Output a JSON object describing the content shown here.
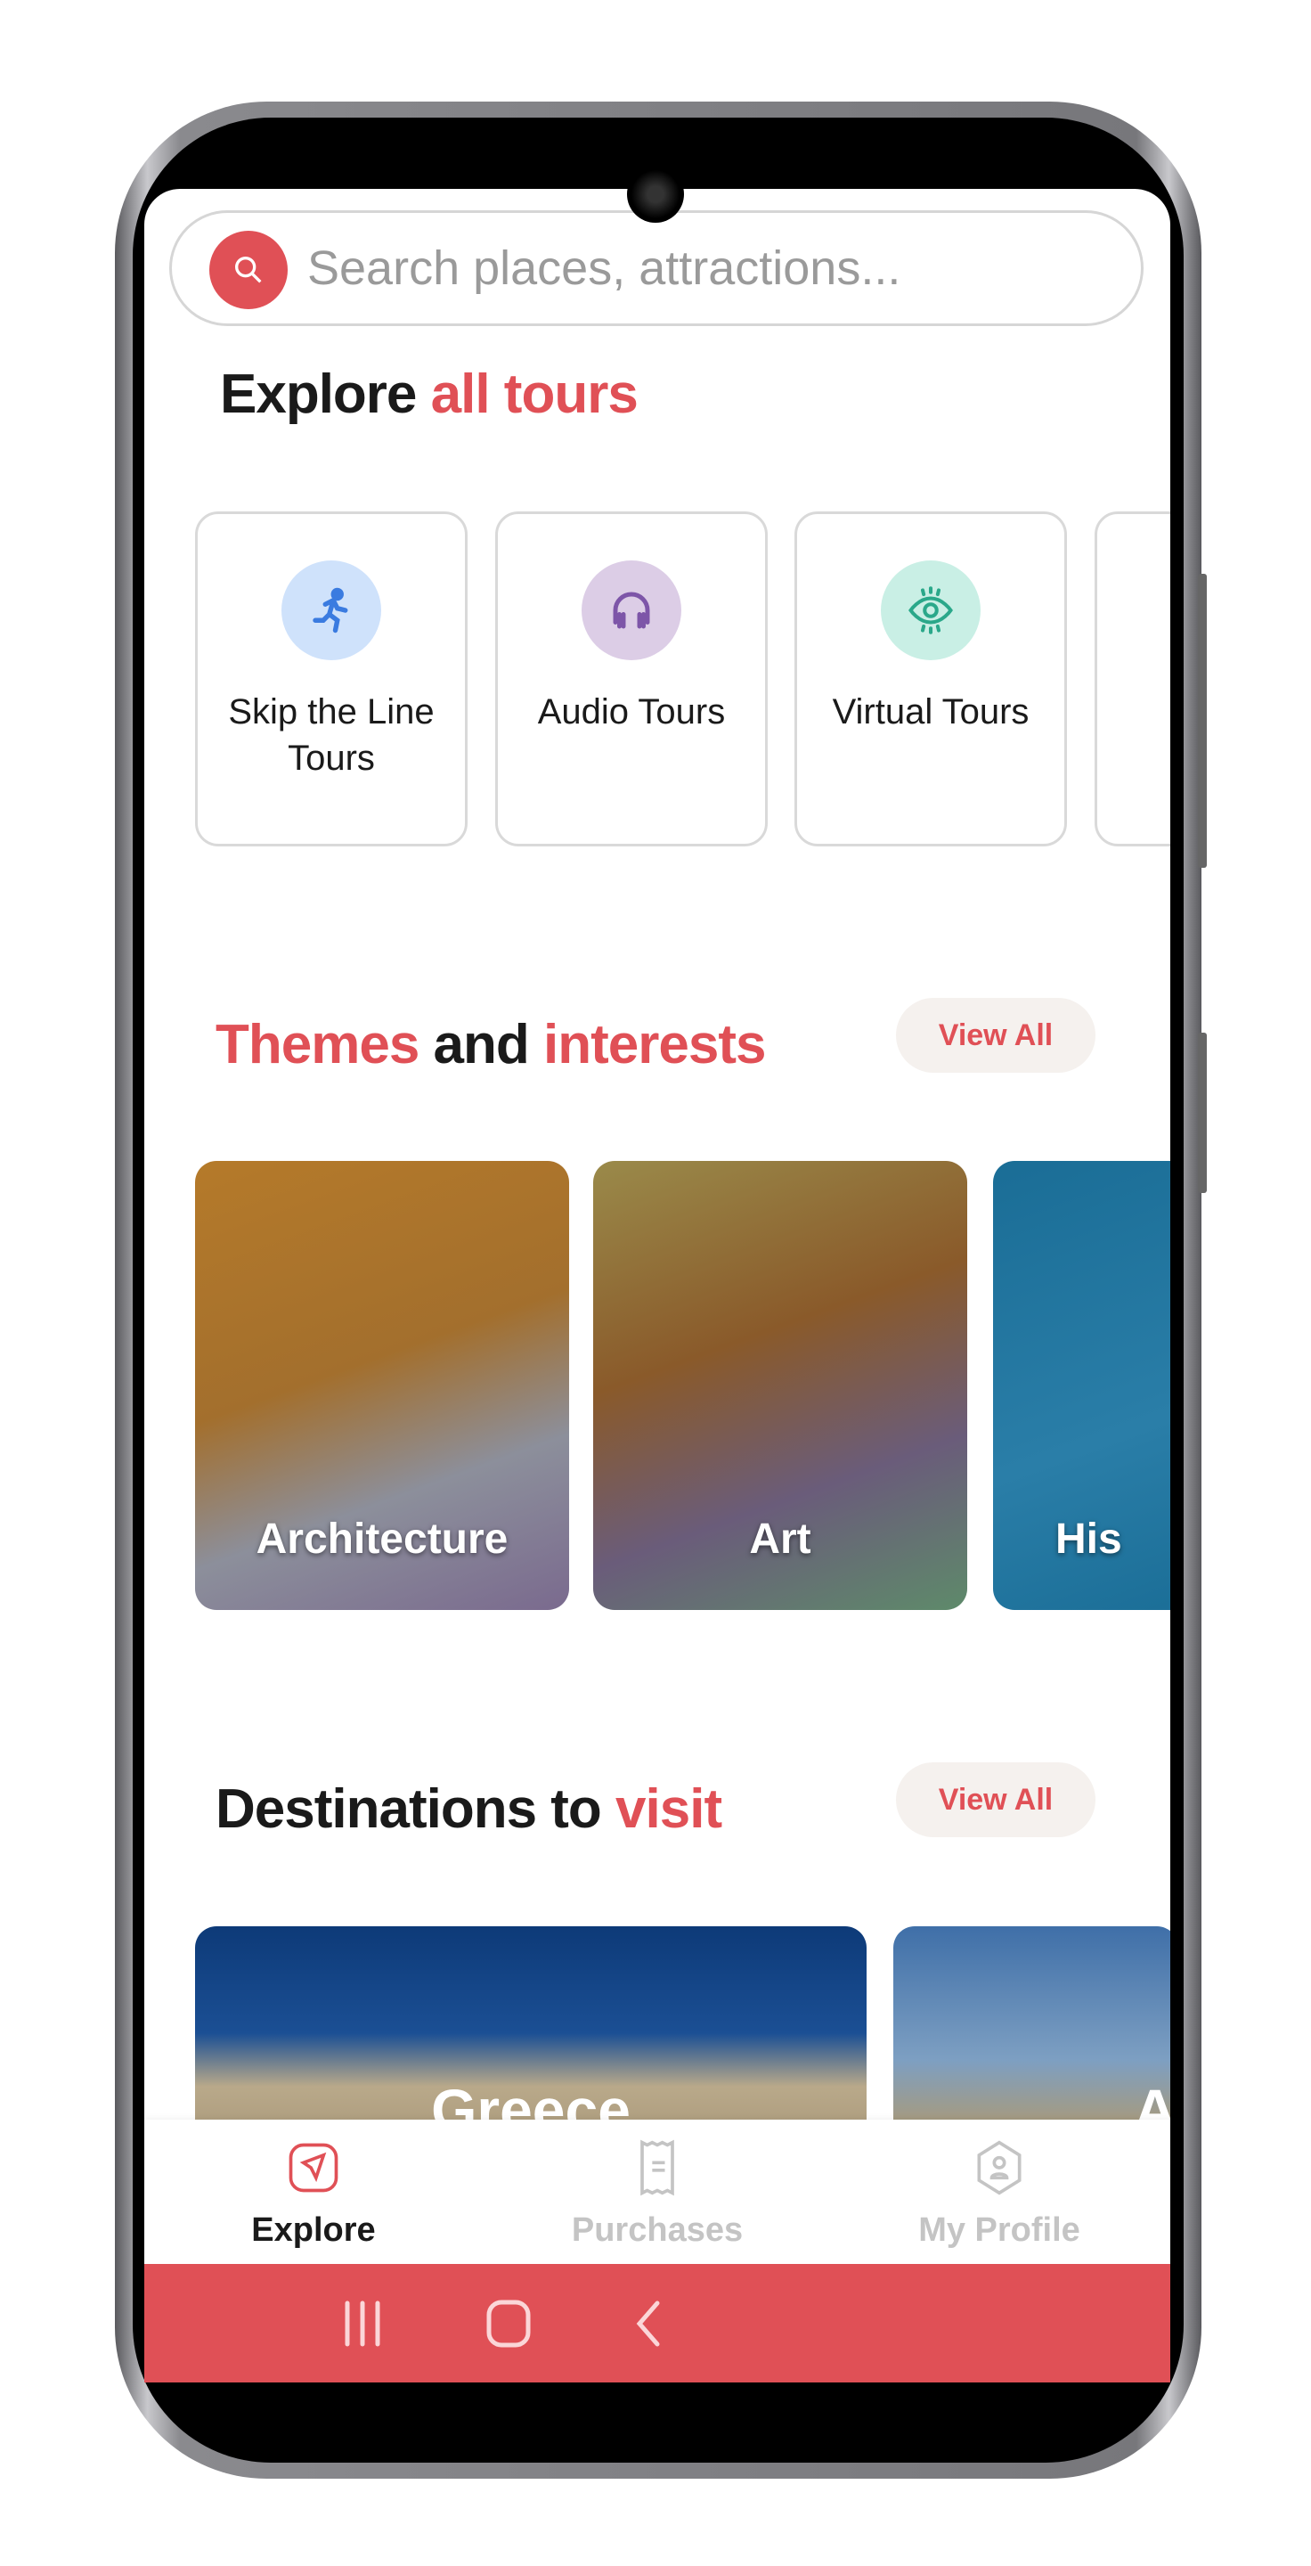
{
  "search": {
    "placeholder": "Search places, attractions..."
  },
  "explore": {
    "title_a": "Explore ",
    "title_b": "all tours",
    "categories": [
      {
        "label": "Skip the Line Tours",
        "icon": "running-person-icon",
        "color": "#3a7be0",
        "bg": "#cfe2fb"
      },
      {
        "label": "Audio Tours",
        "icon": "headphones-icon",
        "color": "#7d55a8",
        "bg": "#dccde6"
      },
      {
        "label": "Virtual Tours",
        "icon": "eye-icon",
        "color": "#2aa88a",
        "bg": "#c9efe5"
      }
    ]
  },
  "themes": {
    "title_a": "Themes",
    "title_b": " and ",
    "title_c": "interests",
    "view_all": "View All",
    "items": [
      {
        "label": "Architecture"
      },
      {
        "label": "Art"
      },
      {
        "label": "His"
      }
    ]
  },
  "destinations": {
    "title_a": "Destinations to ",
    "title_b": "visit",
    "view_all": "View All",
    "items": [
      {
        "label": "Greece"
      },
      {
        "label": "A"
      }
    ]
  },
  "bottom_nav": {
    "items": [
      {
        "label": "Explore",
        "active": true
      },
      {
        "label": "Purchases",
        "active": false
      },
      {
        "label": "My Profile",
        "active": false
      }
    ]
  },
  "colors": {
    "accent": "#e05056",
    "inactive": "#c4c4c4"
  }
}
